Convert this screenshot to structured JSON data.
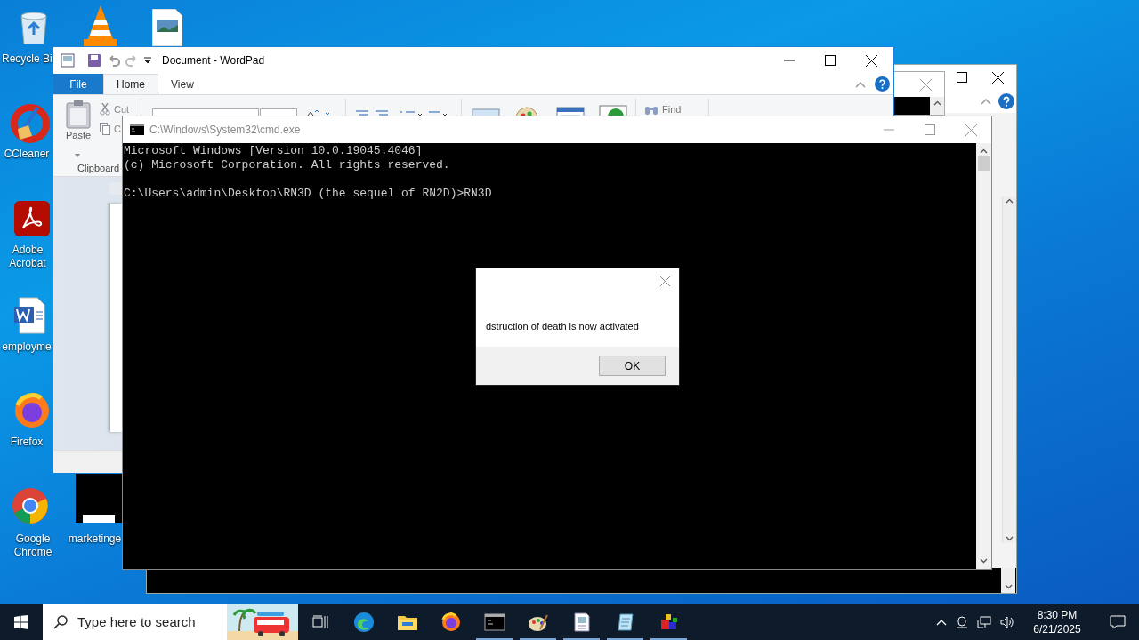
{
  "desktop_icons": [
    {
      "kind": "recycle",
      "label": "Recycle Bi"
    },
    {
      "kind": "ccleaner",
      "label": "CCleaner"
    },
    {
      "kind": "acrobat",
      "label": "Adobe Acrobat"
    },
    {
      "kind": "word",
      "label": "employme"
    },
    {
      "kind": "firefox",
      "label": "Firefox"
    },
    {
      "kind": "chrome",
      "label": "Google Chrome"
    },
    {
      "kind": "thumbnail",
      "label": "marketinge"
    }
  ],
  "wordpad": {
    "title": "Document - WordPad",
    "tabs": [
      {
        "label": "File",
        "kind": "file",
        "selected": false
      },
      {
        "label": "Home",
        "kind": "tab",
        "selected": true
      },
      {
        "label": "View",
        "kind": "tab",
        "selected": false
      }
    ],
    "ribbon": {
      "paste": "Paste",
      "cut": "Cut",
      "copy": "C",
      "find": "Find",
      "group": "Clipboard"
    }
  },
  "cmd": {
    "title": "C:\\Windows\\System32\\cmd.exe",
    "output": [
      "Microsoft Windows [Version 10.0.19045.4046]",
      "(c) Microsoft Corporation. All rights reserved."
    ],
    "prompt": "C:\\Users\\admin\\Desktop\\RN3D (the sequel of RN2D)>RN3D"
  },
  "dialog": {
    "message": "dstruction of death is now activated",
    "button": "OK"
  },
  "taskbar": {
    "search_placeholder": "Type here to search",
    "apps": [
      {
        "kind": "edge",
        "running": false
      },
      {
        "kind": "explorer",
        "running": false
      },
      {
        "kind": "firefox",
        "running": false
      },
      {
        "kind": "cmd",
        "running": true
      },
      {
        "kind": "paint",
        "running": true
      },
      {
        "kind": "wordpad",
        "running": true
      },
      {
        "kind": "notepad",
        "running": true
      },
      {
        "kind": "blocks",
        "running": true
      }
    ],
    "time": "8:30 PM",
    "date": "6/21/2025"
  }
}
